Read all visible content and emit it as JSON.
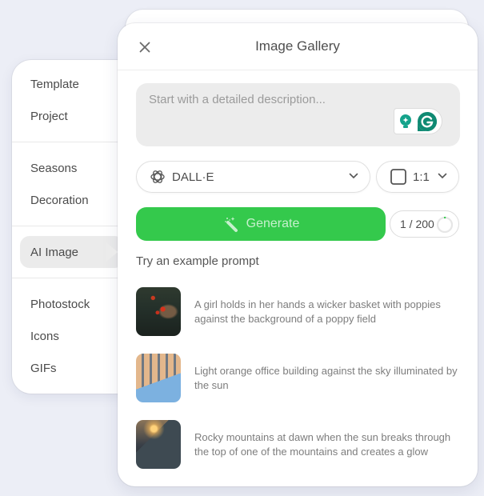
{
  "sidebar": {
    "groups": [
      [
        {
          "label": "Template"
        },
        {
          "label": "Project"
        }
      ],
      [
        {
          "label": "Seasons"
        },
        {
          "label": "Decoration"
        }
      ],
      [
        {
          "label": "AI Image",
          "active": true
        }
      ],
      [
        {
          "label": "Photostock"
        },
        {
          "label": "Icons"
        },
        {
          "label": "GIFs"
        }
      ]
    ]
  },
  "panel": {
    "title": "Image Gallery",
    "close_icon": "close-icon",
    "prompt": {
      "value": "",
      "placeholder": "Start with a detailed description..."
    },
    "grammarly_icons": [
      "lightbulb-icon",
      "grammarly-g-icon"
    ],
    "model": {
      "icon": "openai-logo-icon",
      "label": "DALL·E"
    },
    "ratio": {
      "icon": "square-icon",
      "label": "1:1"
    },
    "generate": {
      "icon": "magic-wand-icon",
      "label": "Generate"
    },
    "counter": {
      "used": 1,
      "total": 200,
      "text": "1 / 200"
    },
    "examples_title": "Try an example prompt",
    "examples": [
      {
        "thumb": "poppy-basket-image",
        "text": "A girl holds in her hands a wicker basket with poppies against the background of a poppy field"
      },
      {
        "thumb": "office-building-image",
        "text": "Light orange office building against the sky illuminated by the sun"
      },
      {
        "thumb": "mountain-dawn-image",
        "text": "Rocky mountains at dawn when the sun breaks through the top of one of the mountains and creates a glow"
      }
    ]
  },
  "colors": {
    "accent_green": "#34c94c",
    "grammarly_teal": "#15a38b",
    "background": "#eceef6"
  }
}
